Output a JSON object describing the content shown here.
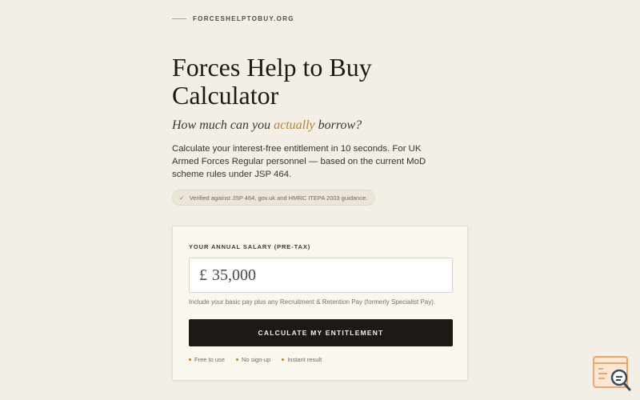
{
  "site": {
    "name": "FORCESHELPTOBUY.ORG"
  },
  "hero": {
    "title": "Forces Help to Buy Calculator",
    "subtitle_before": "How much can you ",
    "subtitle_emphasis": "actually",
    "subtitle_after": " borrow?",
    "description": "Calculate your interest-free entitlement in 10 seconds. For UK Armed Forces Regular personnel — based on the current MoD scheme rules under JSP 464.",
    "verified_icon": "check-icon",
    "verified_text": "Verified against JSP 464, gov.uk and HMRC ITEPA 2003 guidance."
  },
  "calculator": {
    "salary_label": "YOUR ANNUAL SALARY (PRE-TAX)",
    "currency_symbol": "£",
    "salary_value": "35,000",
    "hint": "Include your basic pay plus any Recruitment & Retention Pay (formerly Specialist Pay).",
    "button_label": "CALCULATE MY ENTITLEMENT",
    "features": [
      "Free to use",
      "No sign-up",
      "Instant result"
    ]
  },
  "colors": {
    "background": "#f3efe6",
    "accent": "#b08535",
    "button": "#1d1a16",
    "card": "#faf7ee"
  },
  "icons": {
    "floating_widget": "search-document-icon"
  }
}
